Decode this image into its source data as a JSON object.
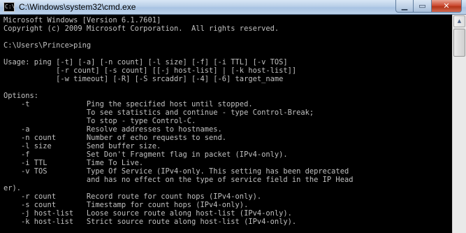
{
  "window": {
    "title": "C:\\Windows\\system32\\cmd.exe",
    "icon": "cmd-icon",
    "icon_glyph": "C:\\",
    "minimize_glyph": "▁",
    "maximize_glyph": "▭",
    "close_glyph": "✕"
  },
  "scrollbar": {
    "up_arrow_glyph": "▲"
  },
  "console": {
    "lines": [
      "Microsoft Windows [Version 6.1.7601]",
      "Copyright (c) 2009 Microsoft Corporation.  All rights reserved.",
      "",
      "C:\\Users\\Prince>ping",
      "",
      "Usage: ping [-t] [-a] [-n count] [-l size] [-f] [-i TTL] [-v TOS]",
      "            [-r count] [-s count] [[-j host-list] | [-k host-list]]",
      "            [-w timeout] [-R] [-S srcaddr] [-4] [-6] target_name",
      "",
      "Options:",
      "    -t             Ping the specified host until stopped.",
      "                   To see statistics and continue - type Control-Break;",
      "                   To stop - type Control-C.",
      "    -a             Resolve addresses to hostnames.",
      "    -n count       Number of echo requests to send.",
      "    -l size        Send buffer size.",
      "    -f             Set Don't Fragment flag in packet (IPv4-only).",
      "    -i TTL         Time To Live.",
      "    -v TOS         Type Of Service (IPv4-only. This setting has been deprecated",
      "                   and has no effect on the type of service field in the IP Head",
      "er).",
      "    -r count       Record route for count hops (IPv4-only).",
      "    -s count       Timestamp for count hops (IPv4-only).",
      "    -j host-list   Loose source route along host-list (IPv4-only).",
      "    -k host-list   Strict source route along host-list (IPv4-only)."
    ]
  },
  "colors": {
    "console_background": "#000000",
    "console_text": "#c0c0c0",
    "close_button": "#c9442b"
  }
}
